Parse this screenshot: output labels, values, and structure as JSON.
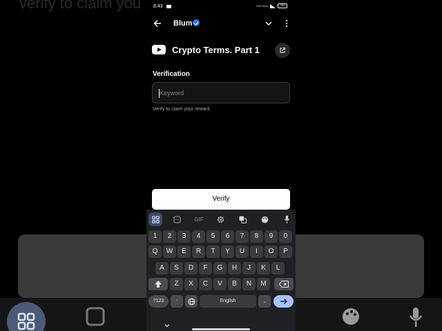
{
  "background": {
    "echo_text": "verify to claim you"
  },
  "status_bar": {
    "time": "8:43",
    "network": "3.80 KB/s",
    "battery": "50"
  },
  "header": {
    "app_name": "Blum"
  },
  "task": {
    "title": "Crypto Terms. Part 1",
    "label": "Verification",
    "input_placeholder": "Keyword",
    "input_value": "",
    "hint": "Verify to claim your reward",
    "button": "Verify"
  },
  "keyboard": {
    "tools": [
      "apps-icon",
      "sticker-icon",
      "GIF",
      "settings-icon",
      "translate-icon",
      "palette-icon",
      "mic-icon"
    ],
    "gif_label": "GIF",
    "row_numbers": [
      "1",
      "2",
      "3",
      "4",
      "5",
      "6",
      "7",
      "8",
      "9",
      "0"
    ],
    "row_top": [
      "Q",
      "W",
      "E",
      "R",
      "T",
      "Y",
      "U",
      "I",
      "O",
      "P"
    ],
    "row_mid": [
      "A",
      "S",
      "D",
      "F",
      "G",
      "H",
      "J",
      "K",
      "L"
    ],
    "row_bot": [
      "Z",
      "X",
      "C",
      "V",
      "B",
      "N",
      "M"
    ],
    "symbols_label": "?123",
    "emoji_key_label": ",",
    "space_label": "English",
    "period_label": "."
  },
  "colors": {
    "accent": "#2f7be8",
    "enter_key": "#a9c3ff",
    "keyboard_bg": "#1f2023"
  }
}
